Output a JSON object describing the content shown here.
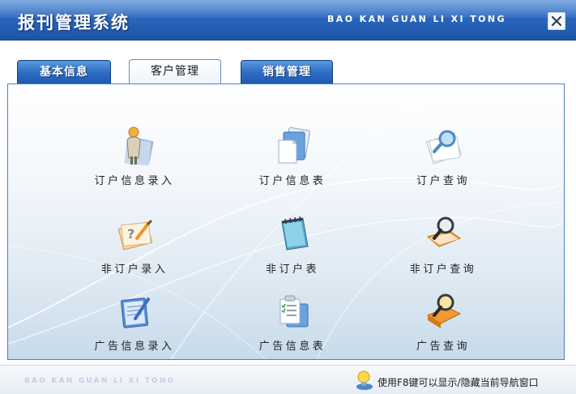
{
  "window": {
    "title": "报刊管理系统",
    "subtitle": "BAO KAN GUAN LI XI TONG"
  },
  "tabs": [
    {
      "label": "基本信息",
      "active": false
    },
    {
      "label": "客户管理",
      "active": true
    },
    {
      "label": "销售管理",
      "active": false
    }
  ],
  "items": [
    {
      "label": "订户信息录入",
      "icon": "person-folder-icon"
    },
    {
      "label": "订户信息表",
      "icon": "documents-icon"
    },
    {
      "label": "订户查询",
      "icon": "magnifier-papers-icon"
    },
    {
      "label": "非订户录入",
      "icon": "question-pen-papers-icon"
    },
    {
      "label": "非订户表",
      "icon": "notepad-icon"
    },
    {
      "label": "非订户查询",
      "icon": "magnifier-orange-folder-icon"
    },
    {
      "label": "广告信息录入",
      "icon": "pen-tablet-icon"
    },
    {
      "label": "广告信息表",
      "icon": "checklist-icon"
    },
    {
      "label": "广告查询",
      "icon": "magnifier-orange-book-icon"
    }
  ],
  "footer": {
    "brand": "BAO KAN GUAN LI XI TONG",
    "hint": "使用F8键可以显示/隐藏当前导航窗口"
  },
  "colors": {
    "titlebar": "#2a66bd",
    "tab_inactive": "#2e6ec4",
    "panel_border": "#4a7fc4"
  }
}
